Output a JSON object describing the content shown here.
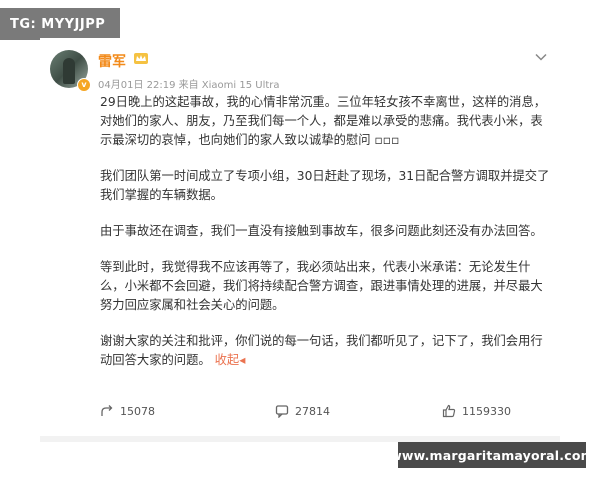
{
  "overlay": {
    "tg_label": "TG: MYYJJPP"
  },
  "post": {
    "author": {
      "name": "雷军",
      "avatar_badge": "v"
    },
    "meta": "04月01日 22:19 来自 Xiaomi 15 Ultra",
    "paragraphs": [
      "29日晚上的这起事故，我的心情非常沉重。三位年轻女孩不幸离世，这样的消息，对她们的家人、朋友，乃至我们每一个人，都是难以承受的悲痛。我代表小米，表示最深切的哀悼，也向她们的家人致以诚挚的慰问 ▫▫▫",
      "我们团队第一时间成立了专项小组，30日赶赴了现场，31日配合警方调取并提交了我们掌握的车辆数据。",
      "由于事故还在调查，我们一直没有接触到事故车，很多问题此刻还没有办法回答。",
      "等到此时，我觉得我不应该再等了，我必须站出来，代表小米承诺：无论发生什么，小米都不会回避，我们将持续配合警方调查，跟进事情处理的进展，并尽最大努力回应家属和社会关心的问题。",
      "谢谢大家的关注和批评，你们说的每一句话，我们都听见了，记下了，我们会用行动回答大家的问题。"
    ],
    "collapse_label": "收起",
    "collapse_arrow": "◂"
  },
  "actions": {
    "repost_count": "15078",
    "comment_count": "27814",
    "like_count": "1159330"
  },
  "watermark": {
    "text": "www.margaritamayoral.com"
  },
  "colors": {
    "username": "#f28a1a",
    "collapse": "#eb7350",
    "badge": "#f5a623"
  },
  "icons": [
    "crown-icon",
    "chevron-down-icon",
    "repost-icon",
    "comment-icon",
    "like-icon"
  ]
}
